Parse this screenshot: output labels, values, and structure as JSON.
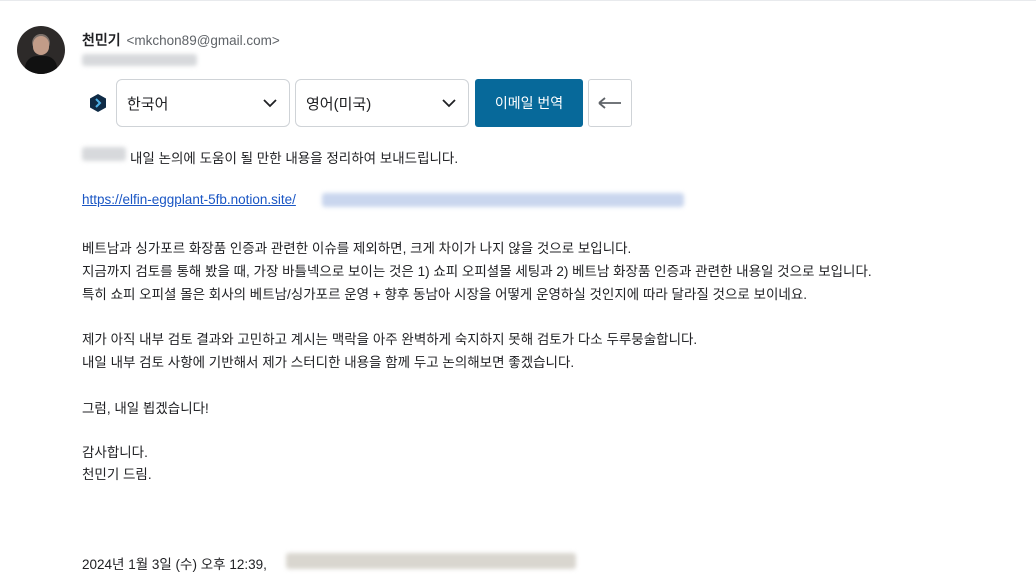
{
  "sender": {
    "name": "천민기",
    "email": "<mkchon89@gmail.com>"
  },
  "translate_bar": {
    "source_language": "한국어",
    "target_language": "영어(미국)",
    "translate_button": "이메일 번역",
    "back_icon": "arrow-left-icon",
    "logo_icon": "translator-logo-icon"
  },
  "message": {
    "intro": "내일 논의에 도움이 될 만한 내용을 정리하여 보내드립니다.",
    "link": "https://elfin-eggplant-5fb.notion.site/",
    "para1_line1": "베트남과 싱가포르 화장품 인증과 관련한 이슈를 제외하면, 크게 차이가 나지 않을 것으로 보입니다.",
    "para1_line2": "지금까지 검토를 통해 봤을 때, 가장 바틀넥으로 보이는 것은 1) 쇼피 오피셜몰 세팅과 2) 베트남 화장품 인증과 관련한 내용일 것으로 보입니다.",
    "para1_line3": "특히 쇼피 오피셜 몰은 회사의 베트남/싱가포르 운영 + 향후 동남아 시장을 어떻게 운영하실 것인지에 따라 달라질 것으로 보이네요.",
    "para2_line1": "제가 아직 내부 검토 결과와 고민하고 계시는 맥락을 아주 완벽하게 숙지하지 못해 검토가 다소 두루뭉술합니다.",
    "para2_line2": "내일 내부 검토 사항에 기반해서 제가 스터디한 내용을 함께 두고 논의해보면 좋겠습니다.",
    "closing": "그럼, 내일 뵙겠습니다!",
    "thanks": "감사합니다.",
    "signature": "천민기 드림.",
    "quoted_header": "2024년 1월 3일 (수) 오후 12:39,"
  }
}
